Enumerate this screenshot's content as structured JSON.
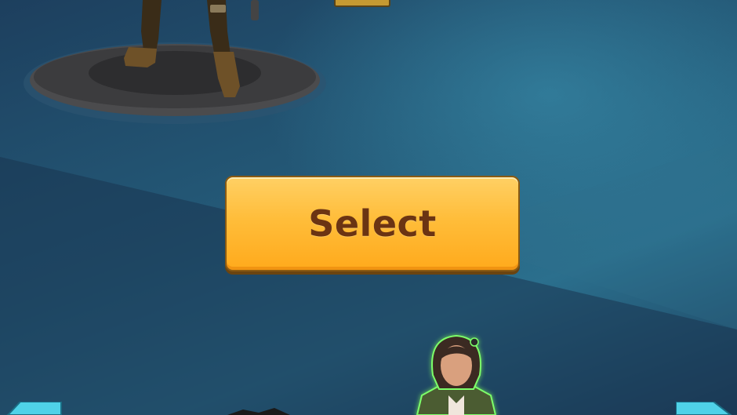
{
  "screen": {
    "select_button": {
      "label": "Select"
    }
  },
  "icons": {
    "left_arrow": "arrow-left-icon",
    "right_arrow": "arrow-right-icon"
  },
  "colors": {
    "button_fill": "#ffbd3a",
    "button_text": "#6b3413",
    "background": "#245a78",
    "character_glow": "#7dff6a"
  }
}
